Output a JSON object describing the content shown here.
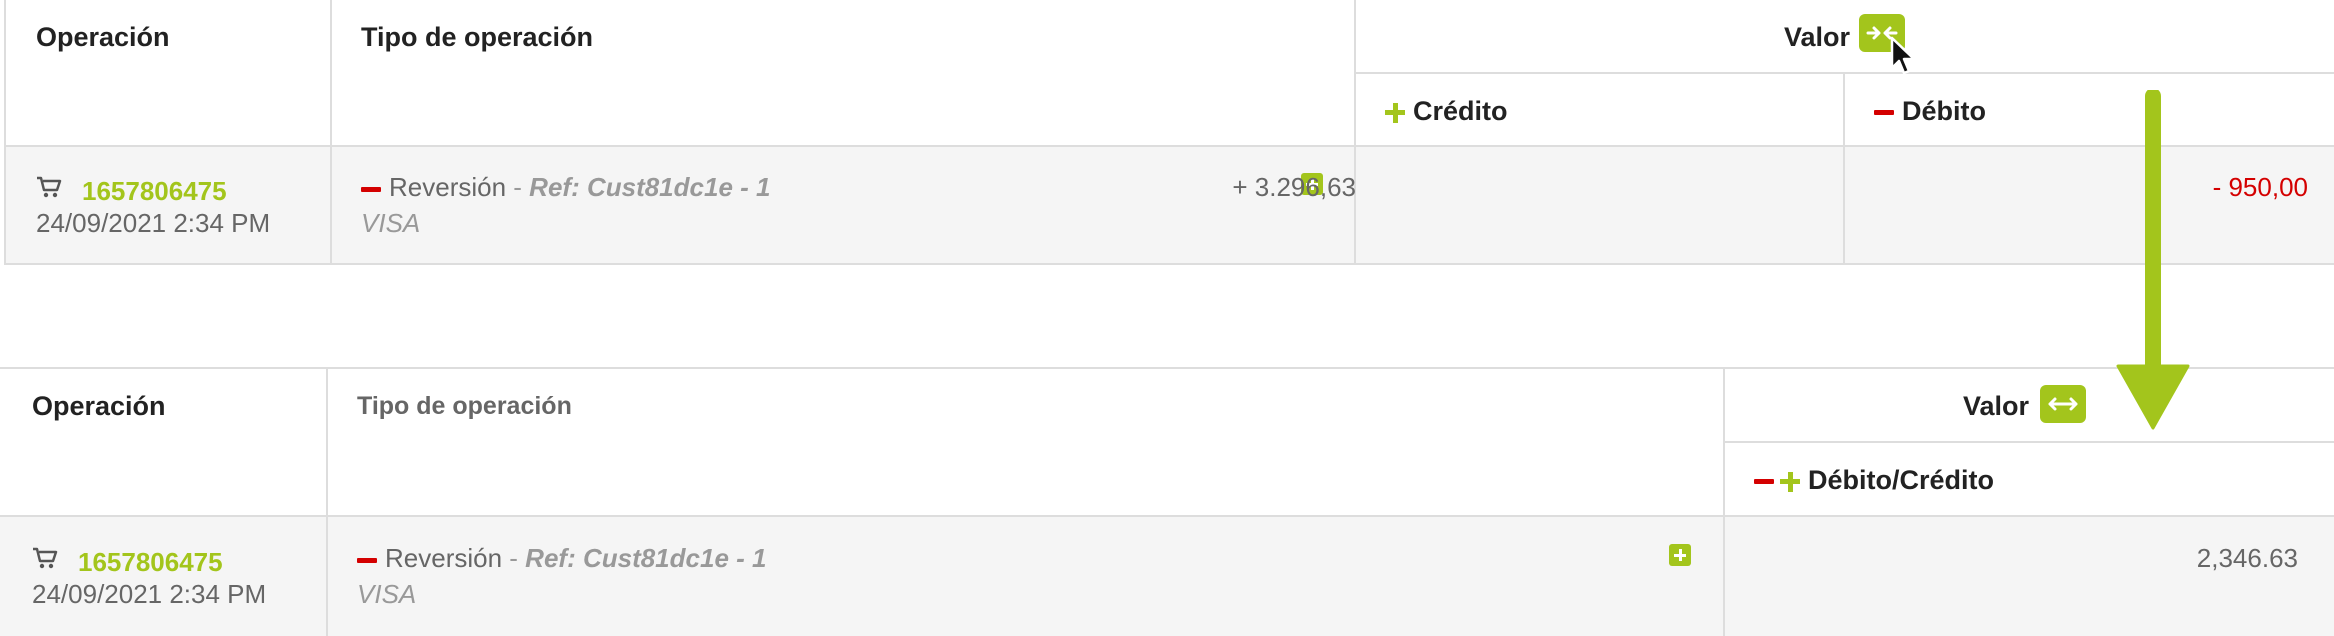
{
  "colors": {
    "accent": "#a3c51c",
    "negative": "#d40000",
    "border": "#dddddd",
    "row_bg": "#f5f5f5"
  },
  "before": {
    "headers": {
      "operacion": "Operación",
      "tipo": "Tipo de operación",
      "valor": "Valor",
      "credito": "Crédito",
      "debito": "Débito"
    },
    "row": {
      "id": "1657806475",
      "date": "24/09/2021 2:34 PM",
      "type": "Reversión",
      "sep": " - ",
      "ref": "Ref: Cust81dc1e - 1",
      "method": "VISA",
      "credit": "+ 3.296,63",
      "debit": "- 950,00"
    },
    "icons": {
      "valor_button": "collapse-columns-icon",
      "cursor": "mouse-cursor-icon"
    }
  },
  "after": {
    "headers": {
      "operacion": "Operación",
      "tipo": "Tipo de operación",
      "valor": "Valor",
      "debito_credito": "Débito/Crédito"
    },
    "row": {
      "id": "1657806475",
      "date": "24/09/2021 2:34 PM",
      "type": "Reversión",
      "sep": " - ",
      "ref": "Ref: Cust81dc1e - 1",
      "method": "VISA",
      "amount": "2,346.63"
    },
    "icons": {
      "valor_button": "expand-columns-icon"
    }
  },
  "annotation": {
    "arrow": "down-arrow-icon"
  }
}
